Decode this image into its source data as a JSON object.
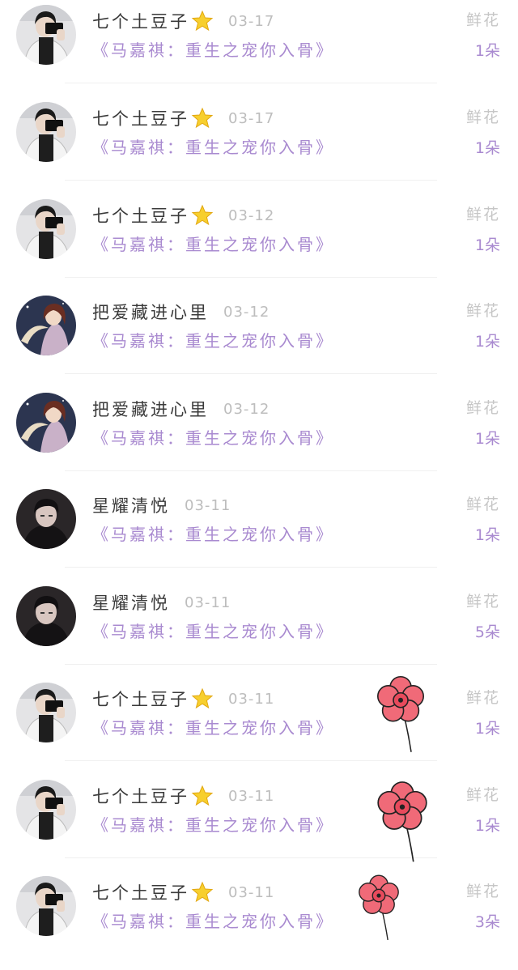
{
  "gift_list": [
    {
      "user": "七个土豆子",
      "badge": "star-icon",
      "date": "03-17",
      "book": "《马嘉祺：重生之宠你入骨》",
      "gift": "鲜花",
      "count": "1朵",
      "avatar": "selfie"
    },
    {
      "user": "七个土豆子",
      "badge": "star-icon",
      "date": "03-17",
      "book": "《马嘉祺：重生之宠你入骨》",
      "gift": "鲜花",
      "count": "1朵",
      "avatar": "selfie"
    },
    {
      "user": "七个土豆子",
      "badge": "star-icon",
      "date": "03-12",
      "book": "《马嘉祺：重生之宠你入骨》",
      "gift": "鲜花",
      "count": "1朵",
      "avatar": "selfie"
    },
    {
      "user": "把爱藏进心里",
      "badge": "",
      "date": "03-12",
      "book": "《马嘉祺：重生之宠你入骨》",
      "gift": "鲜花",
      "count": "1朵",
      "avatar": "moon"
    },
    {
      "user": "把爱藏进心里",
      "badge": "",
      "date": "03-12",
      "book": "《马嘉祺：重生之宠你入骨》",
      "gift": "鲜花",
      "count": "1朵",
      "avatar": "moon"
    },
    {
      "user": "星耀清悦",
      "badge": "",
      "date": "03-11",
      "book": "《马嘉祺：重生之宠你入骨》",
      "gift": "鲜花",
      "count": "1朵",
      "avatar": "dark"
    },
    {
      "user": "星耀清悦",
      "badge": "",
      "date": "03-11",
      "book": "《马嘉祺：重生之宠你入骨》",
      "gift": "鲜花",
      "count": "5朵",
      "avatar": "dark"
    },
    {
      "user": "七个土豆子",
      "badge": "star-icon",
      "date": "03-11",
      "book": "《马嘉祺：重生之宠你入骨》",
      "gift": "鲜花",
      "count": "1朵",
      "avatar": "selfie",
      "flower": true
    },
    {
      "user": "七个土豆子",
      "badge": "star-icon",
      "date": "03-11",
      "book": "《马嘉祺：重生之宠你入骨》",
      "gift": "鲜花",
      "count": "1朵",
      "avatar": "selfie",
      "flower": true
    },
    {
      "user": "七个土豆子",
      "badge": "star-icon",
      "date": "03-11",
      "book": "《马嘉祺：重生之宠你入骨》",
      "gift": "鲜花",
      "count": "3朵",
      "avatar": "selfie",
      "flower": true
    }
  ],
  "colors": {
    "book_title": "#a98ad0",
    "username": "#3a3a3a",
    "date": "#bdbdbd",
    "gift_label": "#c6c6c6",
    "flower": "#f06a78"
  }
}
